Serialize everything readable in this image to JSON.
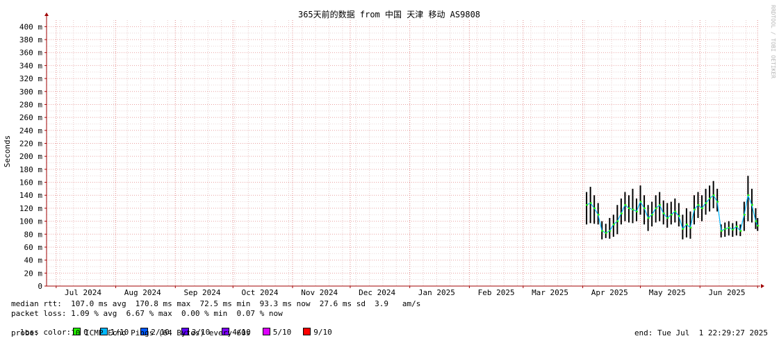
{
  "watermark": "RRDTOOL / TOBI OETIKER",
  "stats": {
    "median_rtt": "median rtt:  107.0 ms avg  170.8 ms max  72.5 ms min  93.3 ms now  27.6 ms sd  3.9   am/s",
    "packet_loss": "packet loss: 1.09 % avg  6.67 % max  0.00 % min  0.07 % now",
    "loss_color_label": "loss color:",
    "probe": "probe:       10 ICMP Echo Pings (64 Bytes) every 60s",
    "end": "end: Tue Jul  1 22:29:27 2025"
  },
  "loss_colors": [
    {
      "label": "0",
      "color": "#26ff00"
    },
    {
      "label": "1/10",
      "color": "#00b8ff"
    },
    {
      "label": "2/10",
      "color": "#0059ff"
    },
    {
      "label": "3/10",
      "color": "#5e00ff"
    },
    {
      "label": "4/10",
      "color": "#7e00ff"
    },
    {
      "label": "5/10",
      "color": "#dd00ff"
    },
    {
      "label": "9/10",
      "color": "#ff0000"
    }
  ],
  "chart_data": {
    "type": "line",
    "title": "365天前的数据 from 中国 天津 移动 AS9808",
    "ylabel": "Seconds",
    "ylim": [
      0,
      0.41
    ],
    "y_ticks": [
      {
        "v": 0,
        "label": "0"
      },
      {
        "v": 0.02,
        "label": "20 m"
      },
      {
        "v": 0.04,
        "label": "40 m"
      },
      {
        "v": 0.06,
        "label": "60 m"
      },
      {
        "v": 0.08,
        "label": "80 m"
      },
      {
        "v": 0.1,
        "label": "100 m"
      },
      {
        "v": 0.12,
        "label": "120 m"
      },
      {
        "v": 0.14,
        "label": "140 m"
      },
      {
        "v": 0.16,
        "label": "160 m"
      },
      {
        "v": 0.18,
        "label": "180 m"
      },
      {
        "v": 0.2,
        "label": "200 m"
      },
      {
        "v": 0.22,
        "label": "220 m"
      },
      {
        "v": 0.24,
        "label": "240 m"
      },
      {
        "v": 0.26,
        "label": "260 m"
      },
      {
        "v": 0.28,
        "label": "280 m"
      },
      {
        "v": 0.3,
        "label": "300 m"
      },
      {
        "v": 0.32,
        "label": "320 m"
      },
      {
        "v": 0.34,
        "label": "340 m"
      },
      {
        "v": 0.36,
        "label": "360 m"
      },
      {
        "v": 0.38,
        "label": "380 m"
      },
      {
        "v": 0.4,
        "label": "400 m"
      }
    ],
    "x_range": [
      "2024-06-26",
      "2025-07-02"
    ],
    "x_ticks": [
      {
        "date": "2024-07-15",
        "label": "Jul 2024"
      },
      {
        "date": "2024-08-15",
        "label": "Aug 2024"
      },
      {
        "date": "2024-09-15",
        "label": "Sep 2024"
      },
      {
        "date": "2024-10-15",
        "label": "Oct 2024"
      },
      {
        "date": "2024-11-15",
        "label": "Nov 2024"
      },
      {
        "date": "2024-12-15",
        "label": "Dec 2024"
      },
      {
        "date": "2025-01-15",
        "label": "Jan 2025"
      },
      {
        "date": "2025-02-15",
        "label": "Feb 2025"
      },
      {
        "date": "2025-03-15",
        "label": "Mar 2025"
      },
      {
        "date": "2025-04-15",
        "label": "Apr 2025"
      },
      {
        "date": "2025-05-15",
        "label": "May 2025"
      },
      {
        "date": "2025-06-15",
        "label": "Jun 2025"
      }
    ],
    "month_lines": [
      "2024-07-01",
      "2024-08-01",
      "2024-09-01",
      "2024-10-01",
      "2024-11-01",
      "2024-12-01",
      "2025-01-01",
      "2025-02-01",
      "2025-03-01",
      "2025-04-01",
      "2025-05-01",
      "2025-06-01",
      "2025-07-01"
    ],
    "series": [
      {
        "values": [
          {
            "date": "2025-04-03",
            "median": 0.125,
            "low": 0.095,
            "high": 0.145
          },
          {
            "date": "2025-04-05",
            "median": 0.128,
            "low": 0.097,
            "high": 0.153
          },
          {
            "date": "2025-04-07",
            "median": 0.12,
            "low": 0.096,
            "high": 0.14
          },
          {
            "date": "2025-04-09",
            "median": 0.11,
            "low": 0.095,
            "high": 0.128
          },
          {
            "date": "2025-04-11",
            "median": 0.085,
            "low": 0.072,
            "high": 0.1
          },
          {
            "date": "2025-04-13",
            "median": 0.082,
            "low": 0.074,
            "high": 0.096
          },
          {
            "date": "2025-04-15",
            "median": 0.085,
            "low": 0.073,
            "high": 0.105
          },
          {
            "date": "2025-04-17",
            "median": 0.095,
            "low": 0.076,
            "high": 0.11
          },
          {
            "date": "2025-04-19",
            "median": 0.1,
            "low": 0.08,
            "high": 0.125
          },
          {
            "date": "2025-04-21",
            "median": 0.112,
            "low": 0.095,
            "high": 0.135
          },
          {
            "date": "2025-04-23",
            "median": 0.125,
            "low": 0.1,
            "high": 0.145
          },
          {
            "date": "2025-04-25",
            "median": 0.12,
            "low": 0.098,
            "high": 0.14
          },
          {
            "date": "2025-04-27",
            "median": 0.118,
            "low": 0.097,
            "high": 0.15
          },
          {
            "date": "2025-04-29",
            "median": 0.115,
            "low": 0.1,
            "high": 0.135
          },
          {
            "date": "2025-05-01",
            "median": 0.13,
            "low": 0.11,
            "high": 0.155
          },
          {
            "date": "2025-05-03",
            "median": 0.12,
            "low": 0.095,
            "high": 0.14
          },
          {
            "date": "2025-05-05",
            "median": 0.105,
            "low": 0.085,
            "high": 0.125
          },
          {
            "date": "2025-05-07",
            "median": 0.11,
            "low": 0.092,
            "high": 0.13
          },
          {
            "date": "2025-05-09",
            "median": 0.12,
            "low": 0.098,
            "high": 0.14
          },
          {
            "date": "2025-05-11",
            "median": 0.125,
            "low": 0.1,
            "high": 0.145
          },
          {
            "date": "2025-05-13",
            "median": 0.112,
            "low": 0.095,
            "high": 0.132
          },
          {
            "date": "2025-05-15",
            "median": 0.105,
            "low": 0.09,
            "high": 0.128
          },
          {
            "date": "2025-05-17",
            "median": 0.11,
            "low": 0.095,
            "high": 0.13
          },
          {
            "date": "2025-05-19",
            "median": 0.115,
            "low": 0.098,
            "high": 0.135
          },
          {
            "date": "2025-05-21",
            "median": 0.108,
            "low": 0.092,
            "high": 0.128
          },
          {
            "date": "2025-05-23",
            "median": 0.088,
            "low": 0.072,
            "high": 0.11
          },
          {
            "date": "2025-05-25",
            "median": 0.095,
            "low": 0.075,
            "high": 0.12
          },
          {
            "date": "2025-05-27",
            "median": 0.09,
            "low": 0.073,
            "high": 0.115
          },
          {
            "date": "2025-05-29",
            "median": 0.118,
            "low": 0.095,
            "high": 0.14
          },
          {
            "date": "2025-05-31",
            "median": 0.125,
            "low": 0.105,
            "high": 0.145
          },
          {
            "date": "2025-06-02",
            "median": 0.12,
            "low": 0.1,
            "high": 0.14
          },
          {
            "date": "2025-06-04",
            "median": 0.128,
            "low": 0.11,
            "high": 0.15
          },
          {
            "date": "2025-06-06",
            "median": 0.135,
            "low": 0.115,
            "high": 0.155
          },
          {
            "date": "2025-06-08",
            "median": 0.14,
            "low": 0.12,
            "high": 0.162
          },
          {
            "date": "2025-06-10",
            "median": 0.13,
            "low": 0.115,
            "high": 0.15
          },
          {
            "date": "2025-06-12",
            "median": 0.085,
            "low": 0.075,
            "high": 0.095
          },
          {
            "date": "2025-06-14",
            "median": 0.088,
            "low": 0.076,
            "high": 0.098
          },
          {
            "date": "2025-06-16",
            "median": 0.09,
            "low": 0.078,
            "high": 0.1
          },
          {
            "date": "2025-06-18",
            "median": 0.087,
            "low": 0.076,
            "high": 0.097
          },
          {
            "date": "2025-06-20",
            "median": 0.092,
            "low": 0.078,
            "high": 0.1
          },
          {
            "date": "2025-06-22",
            "median": 0.085,
            "low": 0.077,
            "high": 0.095
          },
          {
            "date": "2025-06-24",
            "median": 0.11,
            "low": 0.085,
            "high": 0.13
          },
          {
            "date": "2025-06-26",
            "median": 0.14,
            "low": 0.1,
            "high": 0.17
          },
          {
            "date": "2025-06-28",
            "median": 0.125,
            "low": 0.098,
            "high": 0.15
          },
          {
            "date": "2025-06-30",
            "median": 0.1,
            "low": 0.088,
            "high": 0.12
          },
          {
            "date": "2025-07-01",
            "median": 0.093,
            "low": 0.085,
            "high": 0.105
          }
        ]
      }
    ]
  }
}
